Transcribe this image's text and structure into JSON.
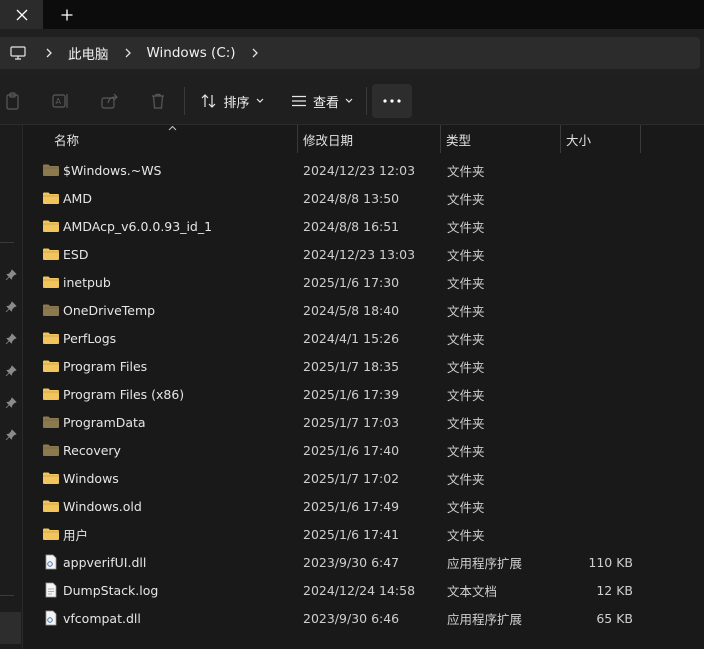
{
  "titlebar": {
    "close_icon": "close-icon",
    "new_tab_icon": "plus-icon"
  },
  "address": {
    "crumbs": [
      "此电脑",
      "Windows (C:)"
    ]
  },
  "toolbar": {
    "sort_label": "排序",
    "view_label": "查看",
    "more_label": "···"
  },
  "columns": {
    "name": "名称",
    "date": "修改日期",
    "type": "类型",
    "size": "大小"
  },
  "files": [
    {
      "name": "$Windows.~WS",
      "date": "2024/12/23 12:03",
      "type": "文件夹",
      "size": "",
      "kind": "folder-dim"
    },
    {
      "name": "AMD",
      "date": "2024/8/8 13:50",
      "type": "文件夹",
      "size": "",
      "kind": "folder"
    },
    {
      "name": "AMDAcp_v6.0.0.93_id_1",
      "date": "2024/8/8 16:51",
      "type": "文件夹",
      "size": "",
      "kind": "folder"
    },
    {
      "name": "ESD",
      "date": "2024/12/23 13:03",
      "type": "文件夹",
      "size": "",
      "kind": "folder"
    },
    {
      "name": "inetpub",
      "date": "2025/1/6 17:30",
      "type": "文件夹",
      "size": "",
      "kind": "folder"
    },
    {
      "name": "OneDriveTemp",
      "date": "2024/5/8 18:40",
      "type": "文件夹",
      "size": "",
      "kind": "folder-dim"
    },
    {
      "name": "PerfLogs",
      "date": "2024/4/1 15:26",
      "type": "文件夹",
      "size": "",
      "kind": "folder"
    },
    {
      "name": "Program Files",
      "date": "2025/1/7 18:35",
      "type": "文件夹",
      "size": "",
      "kind": "folder"
    },
    {
      "name": "Program Files (x86)",
      "date": "2025/1/6 17:39",
      "type": "文件夹",
      "size": "",
      "kind": "folder"
    },
    {
      "name": "ProgramData",
      "date": "2025/1/7 17:03",
      "type": "文件夹",
      "size": "",
      "kind": "folder-dim"
    },
    {
      "name": "Recovery",
      "date": "2025/1/6 17:40",
      "type": "文件夹",
      "size": "",
      "kind": "folder-dim"
    },
    {
      "name": "Windows",
      "date": "2025/1/7 17:02",
      "type": "文件夹",
      "size": "",
      "kind": "folder"
    },
    {
      "name": "Windows.old",
      "date": "2025/1/6 17:49",
      "type": "文件夹",
      "size": "",
      "kind": "folder"
    },
    {
      "name": "用户",
      "date": "2025/1/6 17:41",
      "type": "文件夹",
      "size": "",
      "kind": "folder"
    },
    {
      "name": "appverifUI.dll",
      "date": "2023/9/30 6:47",
      "type": "应用程序扩展",
      "size": "110 KB",
      "kind": "dll"
    },
    {
      "name": "DumpStack.log",
      "date": "2024/12/24 14:58",
      "type": "文本文档",
      "size": "12 KB",
      "kind": "doc"
    },
    {
      "name": "vfcompat.dll",
      "date": "2023/9/30 6:46",
      "type": "应用程序扩展",
      "size": "65 KB",
      "kind": "dll"
    }
  ],
  "colors": {
    "folder": "#f2c55c",
    "folder_dim": "#8c7a4f",
    "bg": "#191919"
  }
}
